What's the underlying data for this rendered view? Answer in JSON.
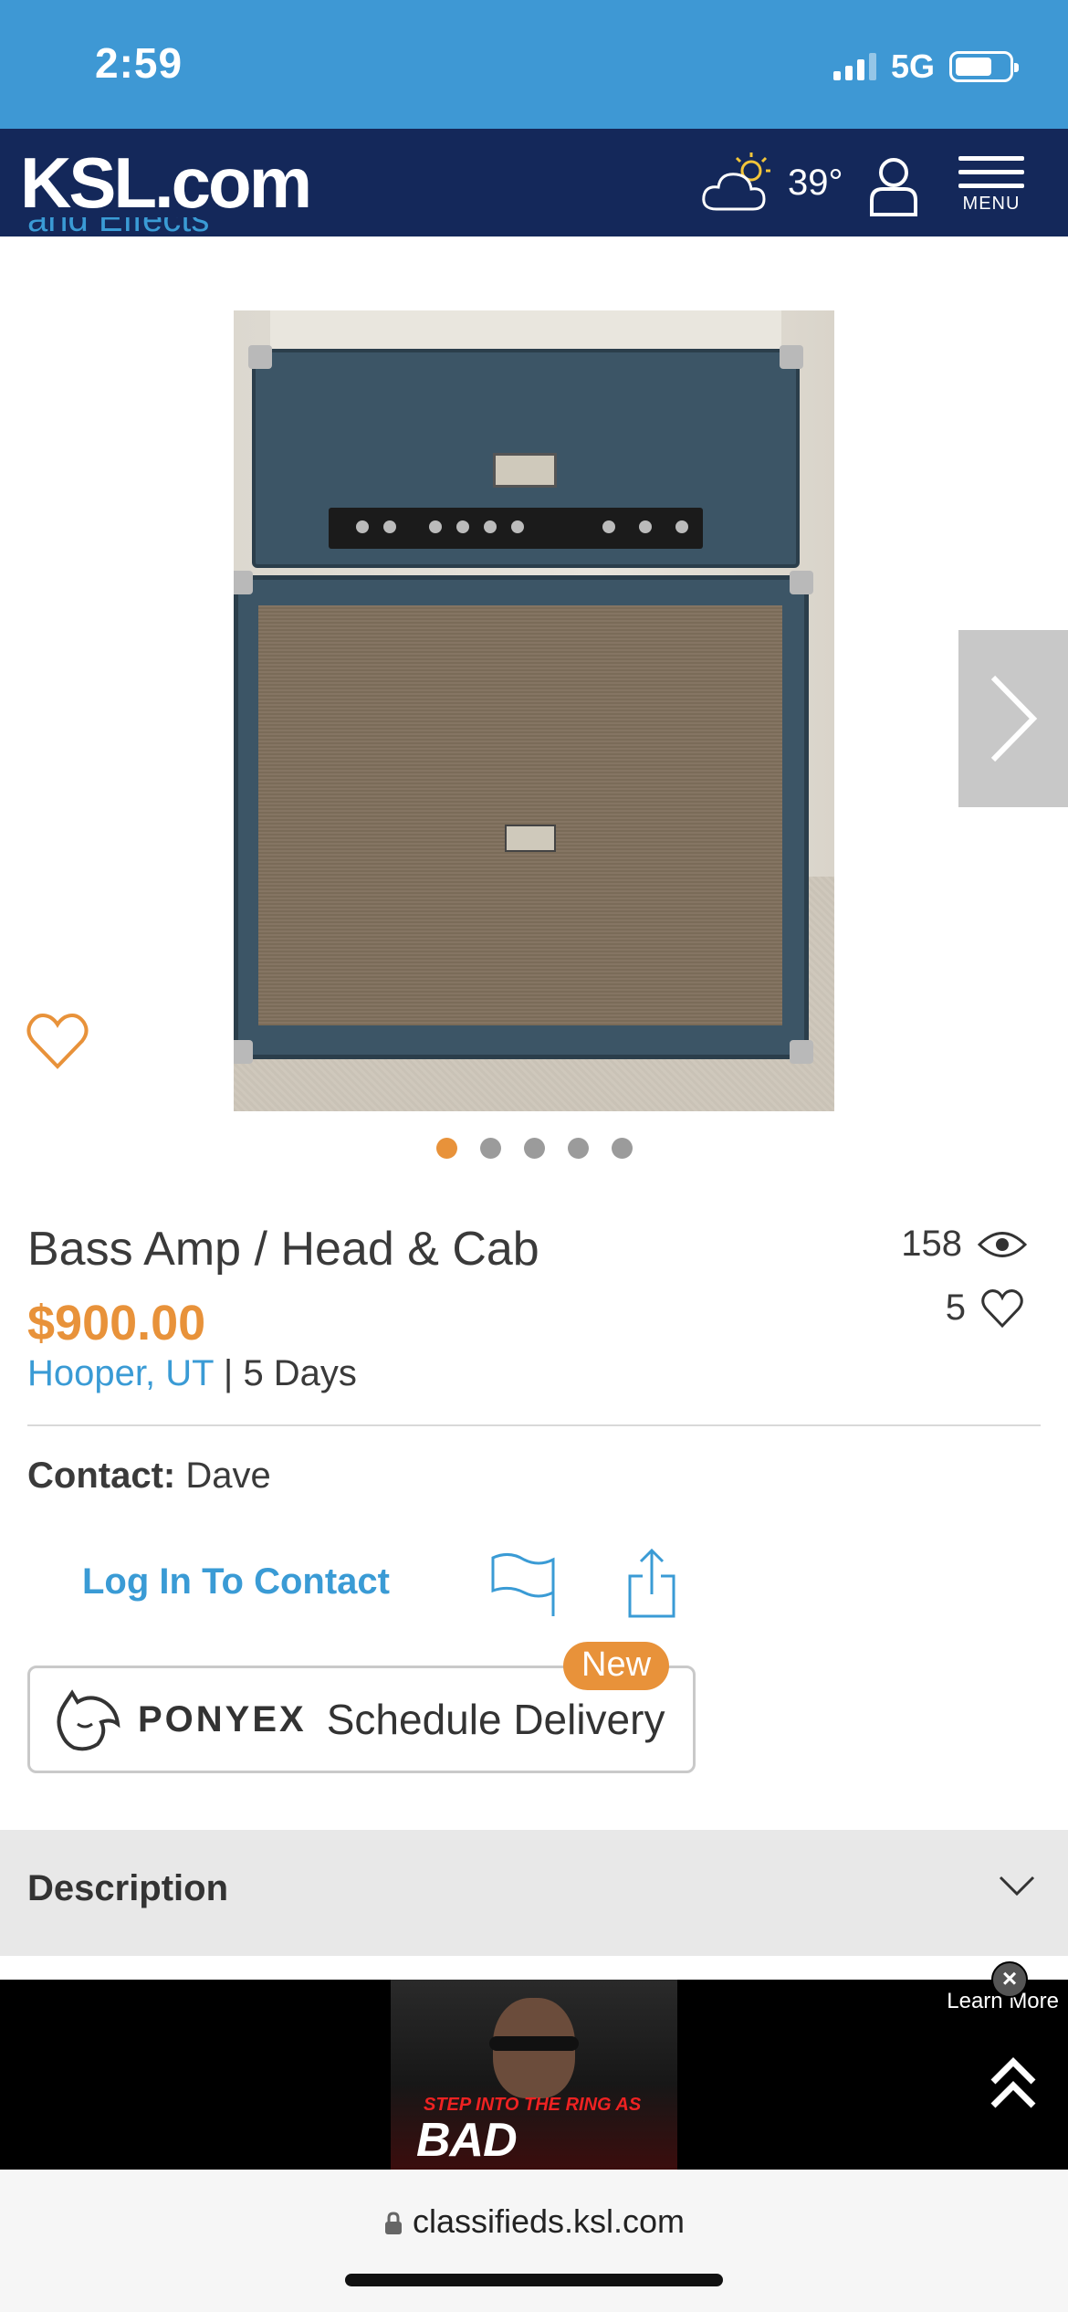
{
  "status_bar": {
    "time": "2:59",
    "network": "5G"
  },
  "header": {
    "logo": "KSL.com",
    "temperature": "39°",
    "menu_label": "MENU"
  },
  "breadcrumb": {
    "partial": "and Effects"
  },
  "gallery": {
    "slide_count": 5,
    "active_slide": 1
  },
  "listing": {
    "title": "Bass Amp / Head & Cab",
    "price": "$900.00",
    "location": "Hooper, UT",
    "age_separator": " | ",
    "age": "5 Days",
    "views": "158",
    "favorites": "5",
    "contact_label": "Contact:",
    "contact_name": "Dave"
  },
  "actions": {
    "login_label": "Log In To Contact"
  },
  "ponyex": {
    "brand": "PONYEX",
    "label": "Schedule Delivery",
    "badge": "New"
  },
  "description": {
    "label": "Description"
  },
  "ad": {
    "tagline": "STEP INTO THE RING AS",
    "name": "BAD BUNNY",
    "learn_more": "Learn More",
    "close": "×"
  },
  "browser": {
    "url": "classifieds.ksl.com"
  },
  "colors": {
    "brand_navy": "#14285a",
    "status_blue": "#3e98d4",
    "accent_orange": "#e8923a",
    "link_blue": "#3a9bd5"
  }
}
